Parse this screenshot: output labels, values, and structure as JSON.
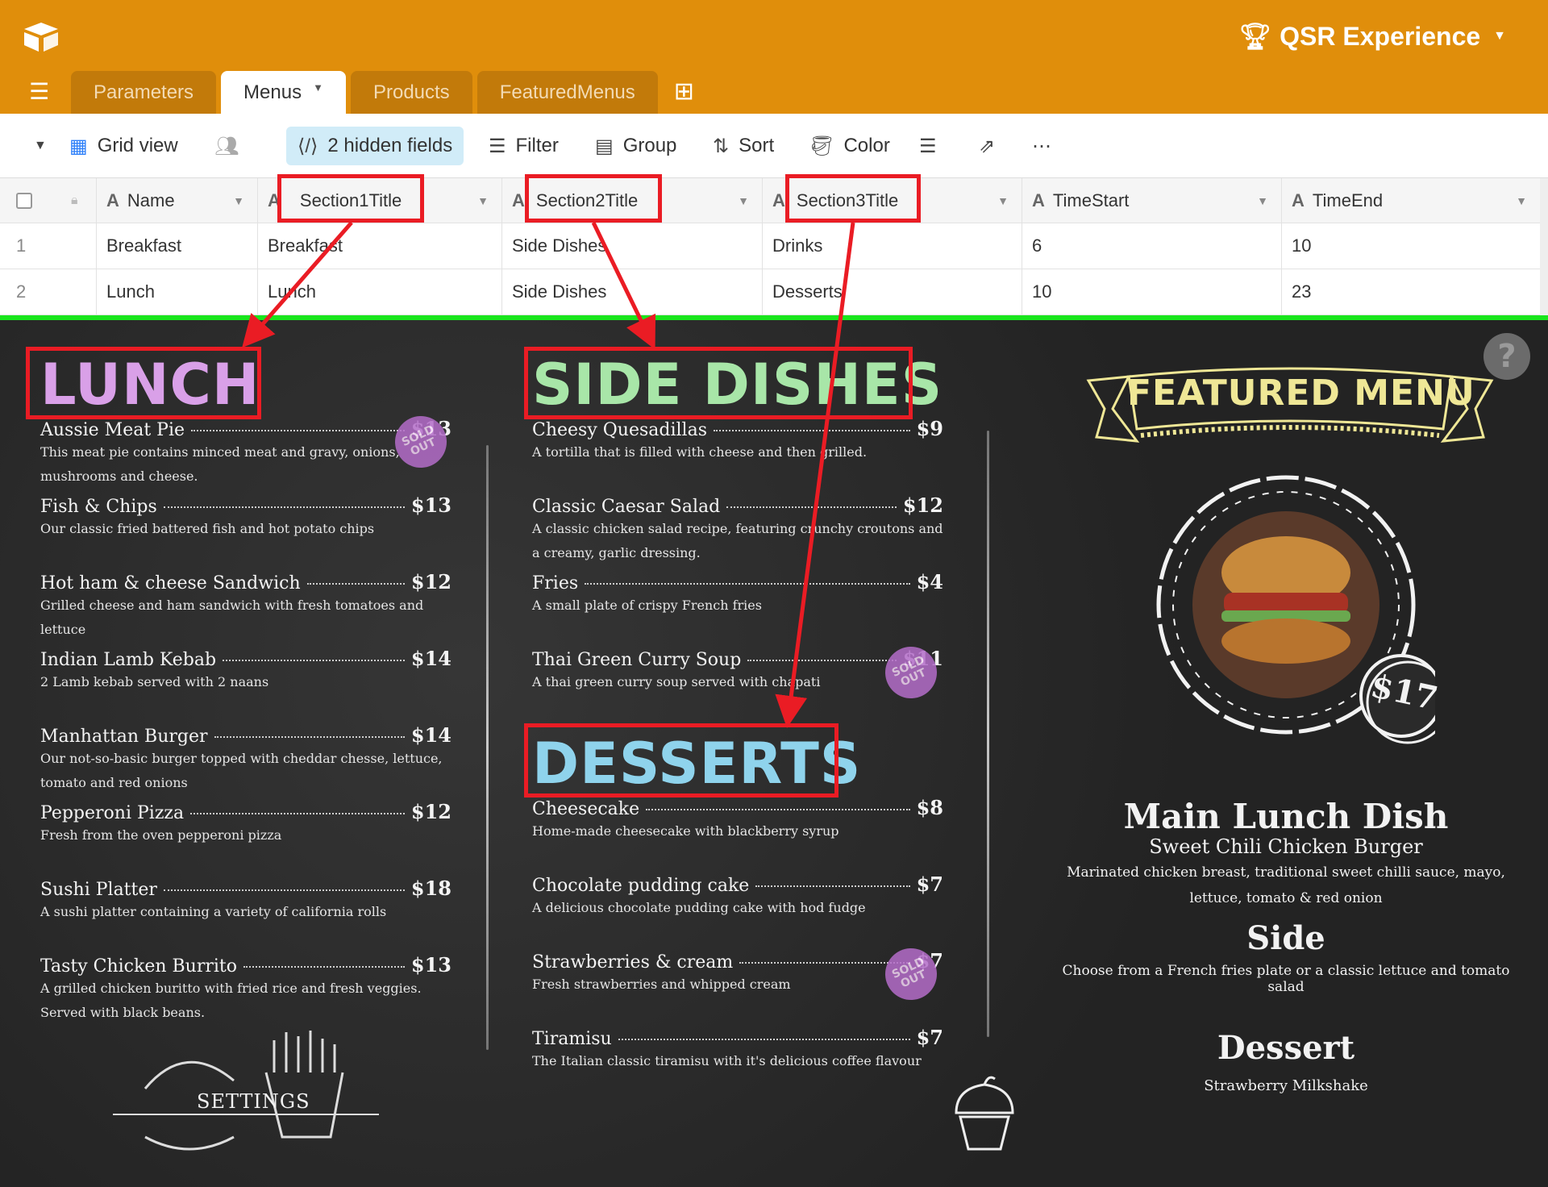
{
  "app": {
    "workspace_name": "QSR Experience",
    "tabs": [
      {
        "label": "Parameters",
        "active": false
      },
      {
        "label": "Menus",
        "active": true
      },
      {
        "label": "Products",
        "active": false
      },
      {
        "label": "FeaturedMenus",
        "active": false
      }
    ]
  },
  "toolbar": {
    "view_name": "Grid view",
    "hidden_fields": "2 hidden fields",
    "filter": "Filter",
    "group": "Group",
    "sort": "Sort",
    "color": "Color"
  },
  "grid": {
    "columns": [
      "Name",
      "Section1Title",
      "Section2Title",
      "Section3Title",
      "TimeStart",
      "TimeEnd"
    ],
    "rows": [
      {
        "num": "1",
        "cells": [
          "Breakfast",
          "Breakfast",
          "Side Dishes",
          "Drinks",
          "6",
          "10"
        ]
      },
      {
        "num": "2",
        "cells": [
          "Lunch",
          "Lunch",
          "Side Dishes",
          "Desserts",
          "10",
          "23"
        ]
      }
    ]
  },
  "board": {
    "section1_title": "LUNCH",
    "section2_title": "SIDE DISHES",
    "section3_title": "DESSERTS",
    "sold_out": "SOLD OUT",
    "lunch_items": [
      {
        "name": "Aussie Meat Pie",
        "price": "$13",
        "desc": "This meat pie contains minced meat and gravy, onions, mushrooms and cheese."
      },
      {
        "name": "Fish & Chips",
        "price": "$13",
        "desc": "Our classic fried battered fish and hot potato chips"
      },
      {
        "name": "Hot ham & cheese Sandwich",
        "price": "$12",
        "desc": "Grilled cheese and ham sandwich with fresh tomatoes and lettuce"
      },
      {
        "name": "Indian Lamb Kebab",
        "price": "$14",
        "desc": "2 Lamb kebab served with 2 naans"
      },
      {
        "name": "Manhattan Burger",
        "price": "$14",
        "desc": "Our not-so-basic burger topped with cheddar chesse, lettuce, tomato and red onions"
      },
      {
        "name": "Pepperoni Pizza",
        "price": "$12",
        "desc": "Fresh from the oven pepperoni pizza"
      },
      {
        "name": "Sushi Platter",
        "price": "$18",
        "desc": "A sushi platter containing a variety of california rolls"
      },
      {
        "name": "Tasty Chicken Burrito",
        "price": "$13",
        "desc": "A grilled chicken buritto with fried rice and fresh veggies. Served with black beans."
      }
    ],
    "side_items": [
      {
        "name": "Cheesy Quesadillas",
        "price": "$9",
        "desc": "A tortilla that is filled with cheese and then grilled."
      },
      {
        "name": "Classic Caesar Salad",
        "price": "$12",
        "desc": "A classic chicken salad recipe, featuring crunchy croutons and a creamy, garlic dressing."
      },
      {
        "name": "Fries",
        "price": "$4",
        "desc": "A small plate of crispy French fries"
      },
      {
        "name": "Thai Green Curry Soup",
        "price": "$11",
        "desc": "A thai green curry soup served with chapati"
      }
    ],
    "dessert_items": [
      {
        "name": "Cheesecake",
        "price": "$8",
        "desc": "Home-made cheesecake with blackberry syrup"
      },
      {
        "name": "Chocolate pudding cake",
        "price": "$7",
        "desc": "A delicious chocolate pudding cake with hod fudge"
      },
      {
        "name": "Strawberries & cream",
        "price": "$7",
        "desc": "Fresh strawberries and whipped cream"
      },
      {
        "name": "Tiramisu",
        "price": "$7",
        "desc": "The Italian classic tiramisu with it's delicious coffee flavour"
      }
    ],
    "settings_label": "SETTINGS",
    "featured": {
      "title": "FEATURED MENU",
      "price": "$17",
      "main_heading": "Main Lunch Dish",
      "main_name": "Sweet Chili Chicken Burger",
      "main_desc": "Marinated chicken breast, traditional sweet chilli sauce, mayo, lettuce, tomato & red onion",
      "side_heading": "Side",
      "side_desc": "Choose from a French fries plate or a classic lettuce and tomato salad",
      "dessert_heading": "Dessert",
      "dessert_name": "Strawberry Milkshake"
    },
    "help": "?"
  },
  "colors": {
    "appbar": "#e08e0b",
    "annotation": "#ea1c24",
    "divider": "#19e61c",
    "lunch_title": "#d9a0e8",
    "side_title": "#a8e6a8",
    "dessert_title": "#8fd3ec",
    "featured_title": "#efe796"
  }
}
